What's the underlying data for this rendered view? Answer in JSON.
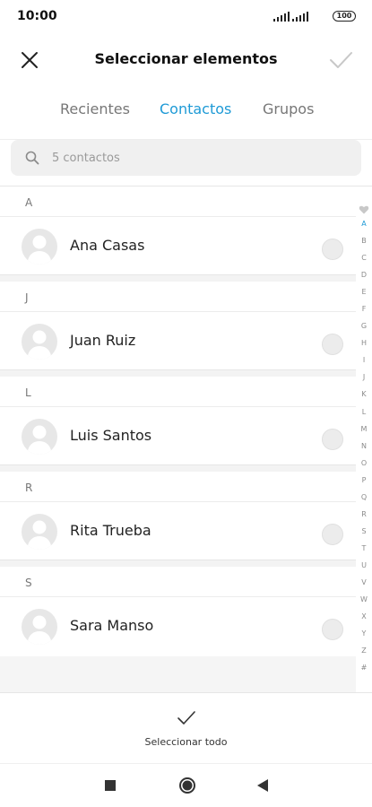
{
  "status_bar": {
    "time": "10:00",
    "battery": "100"
  },
  "header": {
    "title": "Seleccionar elementos",
    "close_icon": "close-icon",
    "confirm_icon": "check-icon"
  },
  "tabs": [
    {
      "label": "Recientes",
      "active": false
    },
    {
      "label": "Contactos",
      "active": true
    },
    {
      "label": "Grupos",
      "active": false
    }
  ],
  "search": {
    "placeholder": "5 contactos"
  },
  "sections": [
    {
      "letter": "A",
      "contacts": [
        {
          "name": "Ana Casas",
          "selected": false
        }
      ]
    },
    {
      "letter": "J",
      "contacts": [
        {
          "name": "Juan Ruiz",
          "selected": false
        }
      ]
    },
    {
      "letter": "L",
      "contacts": [
        {
          "name": "Luis Santos",
          "selected": false
        }
      ]
    },
    {
      "letter": "R",
      "contacts": [
        {
          "name": "Rita Trueba",
          "selected": false
        }
      ]
    },
    {
      "letter": "S",
      "contacts": [
        {
          "name": "Sara Manso",
          "selected": false
        }
      ]
    }
  ],
  "alphabet_index": {
    "favorites_icon": "heart-icon",
    "active_letter": "A",
    "letters": [
      "A",
      "B",
      "C",
      "D",
      "E",
      "F",
      "G",
      "H",
      "I",
      "J",
      "K",
      "L",
      "M",
      "N",
      "O",
      "P",
      "Q",
      "R",
      "S",
      "T",
      "U",
      "V",
      "W",
      "X",
      "Y",
      "Z",
      "#"
    ]
  },
  "bottom_action": {
    "label": "Seleccionar todo",
    "icon": "check-icon"
  },
  "colors": {
    "accent": "#1e9ad6"
  }
}
